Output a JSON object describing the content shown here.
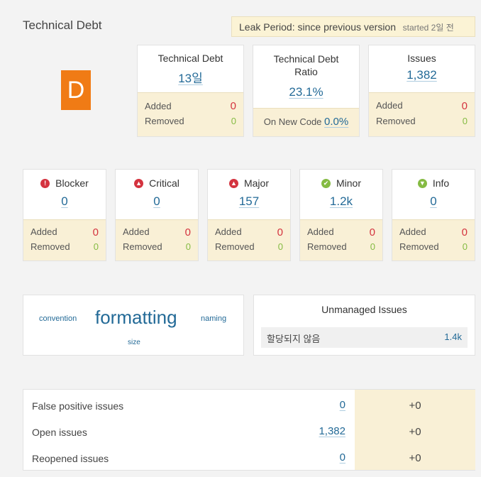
{
  "header": {
    "title": "Technical Debt",
    "leak_period": "Leak Period: since previous version",
    "leak_started": "started 2일 전"
  },
  "rating": {
    "letter": "D",
    "color": "#f07b15"
  },
  "summary": [
    {
      "title": "Technical Debt",
      "value": "13일",
      "added_label": "Added",
      "added": "0",
      "removed_label": "Removed",
      "removed": "0"
    },
    {
      "title": "Technical Debt Ratio",
      "value": "23.1%",
      "new_code_label": "On New Code",
      "new_code_value": "0.0%"
    },
    {
      "title": "Issues",
      "value": "1,382",
      "added_label": "Added",
      "added": "0",
      "removed_label": "Removed",
      "removed": "0"
    }
  ],
  "severities": [
    {
      "name": "Blocker",
      "icon": "blocker-icon",
      "color": "#d4333f",
      "value": "0",
      "added": "0",
      "removed": "0"
    },
    {
      "name": "Critical",
      "icon": "critical-icon",
      "color": "#d4333f",
      "value": "0",
      "added": "0",
      "removed": "0"
    },
    {
      "name": "Major",
      "icon": "major-icon",
      "color": "#d4333f",
      "value": "157",
      "added": "0",
      "removed": "0"
    },
    {
      "name": "Minor",
      "icon": "minor-icon",
      "color": "#85bb43",
      "value": "1.2k",
      "added": "0",
      "removed": "0"
    },
    {
      "name": "Info",
      "icon": "info-icon",
      "color": "#85bb43",
      "value": "0",
      "added": "0",
      "removed": "0"
    }
  ],
  "labels": {
    "added": "Added",
    "removed": "Removed"
  },
  "tag_cloud": {
    "convention": "convention",
    "formatting": "formatting",
    "naming": "naming",
    "size": "size"
  },
  "unmanaged": {
    "title": "Unmanaged Issues",
    "row_label": "할당되지 않음",
    "row_value": "1.4k"
  },
  "issues_table": [
    {
      "label": "False positive issues",
      "value": "0",
      "delta": "+0"
    },
    {
      "label": "Open issues",
      "value": "1,382",
      "delta": "+0"
    },
    {
      "label": "Reopened issues",
      "value": "0",
      "delta": "+0"
    }
  ]
}
